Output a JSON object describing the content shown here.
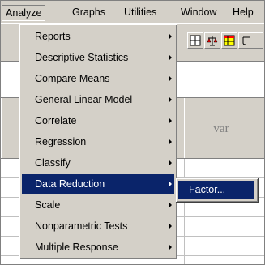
{
  "menubar": {
    "items": [
      {
        "label": "Analyze"
      },
      {
        "label": "Graphs"
      },
      {
        "label": "Utilities"
      },
      {
        "label": "Window"
      },
      {
        "label": "Help"
      }
    ]
  },
  "analyze_menu": {
    "items": [
      {
        "label": "Reports",
        "submenu": true
      },
      {
        "label": "Descriptive Statistics",
        "submenu": true
      },
      {
        "label": "Compare Means",
        "submenu": true
      },
      {
        "label": "General Linear Model",
        "submenu": true
      },
      {
        "label": "Correlate",
        "submenu": true
      },
      {
        "label": "Regression",
        "submenu": true
      },
      {
        "label": "Classify",
        "submenu": true
      },
      {
        "label": "Data Reduction",
        "submenu": true,
        "highlighted": true
      },
      {
        "label": "Scale",
        "submenu": true
      },
      {
        "label": "Nonparametric Tests",
        "submenu": true
      },
      {
        "label": "Multiple Response",
        "submenu": true
      }
    ]
  },
  "data_reduction_submenu": {
    "items": [
      {
        "label": "Factor..."
      }
    ]
  },
  "grid": {
    "column_header": "var"
  },
  "colors": {
    "menu_bg": "#d4d0c8",
    "highlight": "#0a246a",
    "highlight_text": "#ffffff"
  }
}
